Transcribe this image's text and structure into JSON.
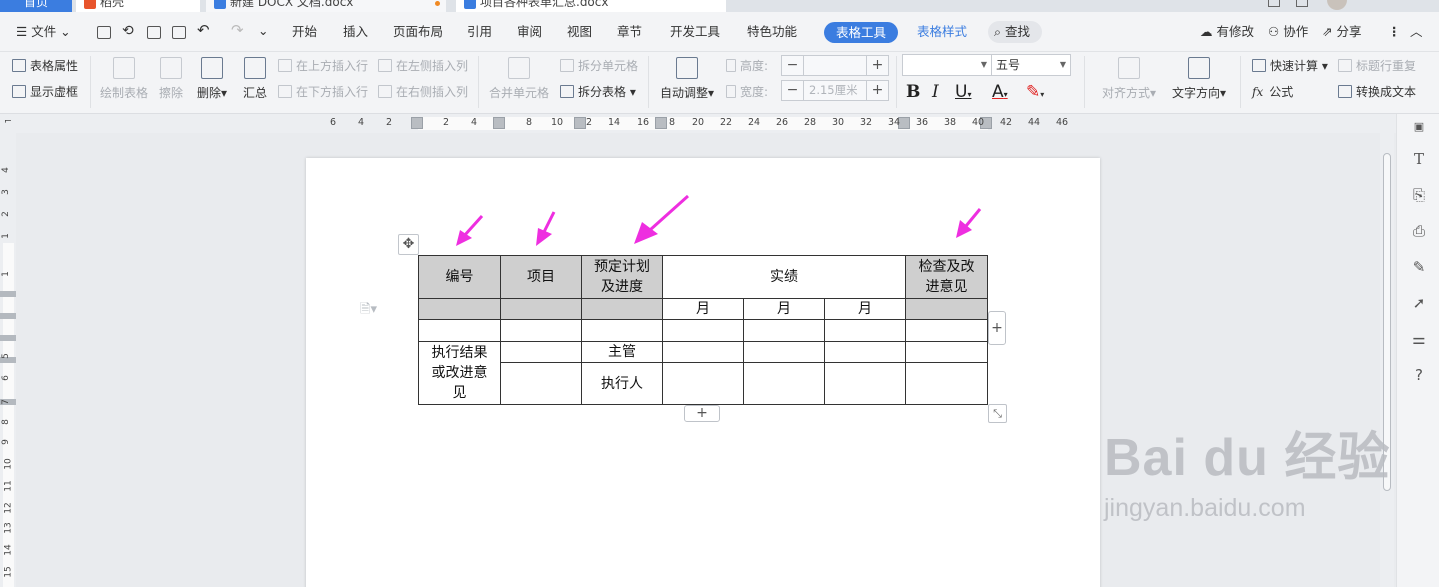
{
  "tabs": [
    {
      "label": "首页",
      "color": "#3b7de0"
    },
    {
      "label": "稻壳",
      "color": "#e8542c"
    },
    {
      "label": "新建 DOCX 文档.docx",
      "color": "#3b7de0"
    },
    {
      "label": "项目各种表单汇总.docx",
      "color": "#3b7de0"
    }
  ],
  "menu": {
    "file": "文件",
    "items": [
      "开始",
      "插入",
      "页面布局",
      "引用",
      "审阅",
      "视图",
      "章节",
      "开发工具",
      "特色功能"
    ],
    "table_tools": "表格工具",
    "table_style": "表格样式",
    "search": "查找",
    "modified": "有修改",
    "collab": "协作",
    "share": "分享"
  },
  "ribbon": {
    "table_props": "表格属性",
    "show_grid": "显示虚框",
    "draw_table": "绘制表格",
    "erase": "擦除",
    "delete": "删除",
    "summary": "汇总",
    "insert_row_above": "在上方插入行",
    "insert_row_below": "在下方插入行",
    "insert_col_left": "在左侧插入列",
    "insert_col_right": "在右侧插入列",
    "merge_cells": "合并单元格",
    "split_cells": "拆分单元格",
    "split_table": "拆分表格",
    "auto_fit": "自动调整",
    "height_label": "高度:",
    "width_label": "宽度:",
    "width_value": "2.15厘米",
    "font_size": "五号",
    "align": "对齐方式",
    "text_dir": "文字方向",
    "quick_calc": "快速计算",
    "repeat_header": "标题行重复",
    "formula": "公式",
    "to_text": "转换成文本"
  },
  "ruler": {
    "h_left": [
      "6",
      "4",
      "2"
    ],
    "h_right": [
      "2",
      "4",
      "8",
      "10",
      "2",
      "14",
      "16",
      "8",
      "20",
      "22",
      "24",
      "26",
      "28",
      "30",
      "32",
      "34",
      "36",
      "38",
      "40",
      "42",
      "44",
      "46"
    ],
    "v": [
      "4",
      "3",
      "2",
      "1",
      "1",
      "2",
      "3",
      "4",
      "5",
      "6",
      "7",
      "8",
      "9",
      "10",
      "11",
      "12",
      "13",
      "14",
      "15"
    ]
  },
  "table": {
    "h_id": "编号",
    "h_item": "项目",
    "h_plan": "预定计划及进度",
    "h_actual": "实绩",
    "h_check": "检查及改进意见",
    "months": [
      "月",
      "月",
      "月"
    ],
    "result": "执行结果或改进意见",
    "supervisor": "主管",
    "executor": "执行人"
  },
  "watermark": {
    "logo": "Bai du 经验",
    "url": "jingyan.baidu.com"
  },
  "colors": {
    "accent": "#3b7de0",
    "arrow": "#ee2ee0",
    "header_fill": "#cfcfcf"
  }
}
